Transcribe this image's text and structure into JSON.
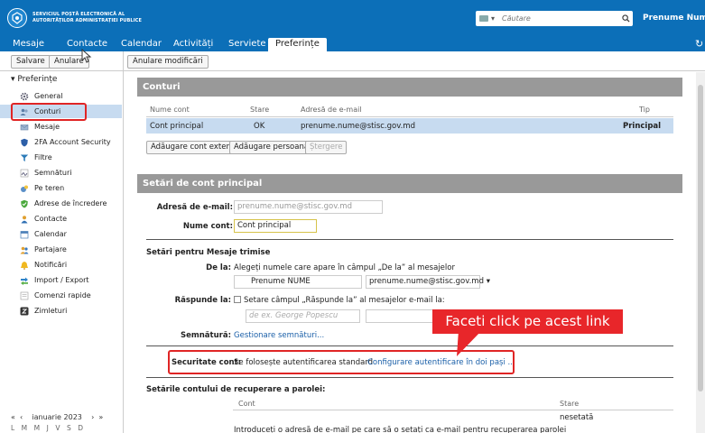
{
  "header": {
    "logo_line1": "SERVICIUL POȘTĂ ELECTRONICĂ AL",
    "logo_line2": "AUTORITĂȚILOR ADMINISTRAȚIEI PUBLICE",
    "search_placeholder": "Căutare",
    "user_name": "Prenume Nume"
  },
  "tabs": [
    {
      "label": "Mesaje"
    },
    {
      "label": "Contacte"
    },
    {
      "label": "Calendar"
    },
    {
      "label": "Activități"
    },
    {
      "label": "Serviete"
    },
    {
      "label": "Preferințe"
    }
  ],
  "toolbar": {
    "save": "Salvare",
    "cancel": "Anulare",
    "undo_changes": "Anulare modificări"
  },
  "sidebar": {
    "root": "Preferințe",
    "items": [
      {
        "label": "General",
        "icon": "gear-icon"
      },
      {
        "label": "Conturi",
        "icon": "accounts-icon"
      },
      {
        "label": "Mesaje",
        "icon": "mail-icon"
      },
      {
        "label": "2FA Account Security",
        "icon": "shield-icon"
      },
      {
        "label": "Filtre",
        "icon": "filter-icon"
      },
      {
        "label": "Semnături",
        "icon": "signature-icon"
      },
      {
        "label": "Pe teren",
        "icon": "out-of-office-icon"
      },
      {
        "label": "Adrese de încredere",
        "icon": "trusted-icon"
      },
      {
        "label": "Contacte",
        "icon": "contacts-icon"
      },
      {
        "label": "Calendar",
        "icon": "calendar-icon"
      },
      {
        "label": "Partajare",
        "icon": "sharing-icon"
      },
      {
        "label": "Notificări",
        "icon": "bell-icon"
      },
      {
        "label": "Import / Export",
        "icon": "import-export-icon"
      },
      {
        "label": "Comenzi rapide",
        "icon": "keyboard-icon"
      },
      {
        "label": "Zimleturi",
        "icon": "zimlet-icon"
      }
    ],
    "calendar_month": "ianuarie 2023",
    "calendar_days": "LMMJVSD"
  },
  "accounts": {
    "title": "Conturi",
    "columns": [
      "Nume cont",
      "Stare",
      "Adresă de e-mail",
      "Tip"
    ],
    "row": {
      "name": "Cont principal",
      "status": "OK",
      "email": "prenume.nume@stisc.gov.md",
      "type": "Principal"
    },
    "btn_add_external": "Adăugare cont extern",
    "btn_add_persona": "Adăugare persoană",
    "btn_delete": "Ștergere"
  },
  "primary": {
    "title": "Setări de cont principal",
    "email_label": "Adresă de e-mail:",
    "email_value": "prenume.nume@stisc.gov.md",
    "account_name_label": "Nume cont:",
    "account_name_value": "Cont principal",
    "sent_title": "Setări pentru Mesaje trimise",
    "from_label": "De la:",
    "from_text": "Alegeți numele care apare în câmpul „De la” al mesajelor",
    "from_name": "Prenume NUME",
    "from_address": "prenume.nume@stisc.gov.md",
    "reply_label": "Răspunde la:",
    "reply_text": "Setare câmpul „Răspunde la” al mesajelor e-mail la:",
    "reply_placeholder": "de ex. George Popescu",
    "signature_label": "Semnătură:",
    "signature_link": "Gestionare semnături...",
    "security_label": "Securitate cont:",
    "security_text": "Se folosește autentificarea standard",
    "security_link": "Configurare autentificare în doi pași ...",
    "recovery_title": "Setările contului de recuperare a parolei:",
    "recovery_col_account": "Cont",
    "recovery_col_status": "Stare",
    "recovery_status": "nesetată",
    "recovery_hint": "Introduceți o adresă de e-mail pe care să o setați ca e-mail pentru recuperarea parolei"
  },
  "annotation": {
    "callout": "Faceti click  pe acest link",
    "color": "#e8262a"
  }
}
